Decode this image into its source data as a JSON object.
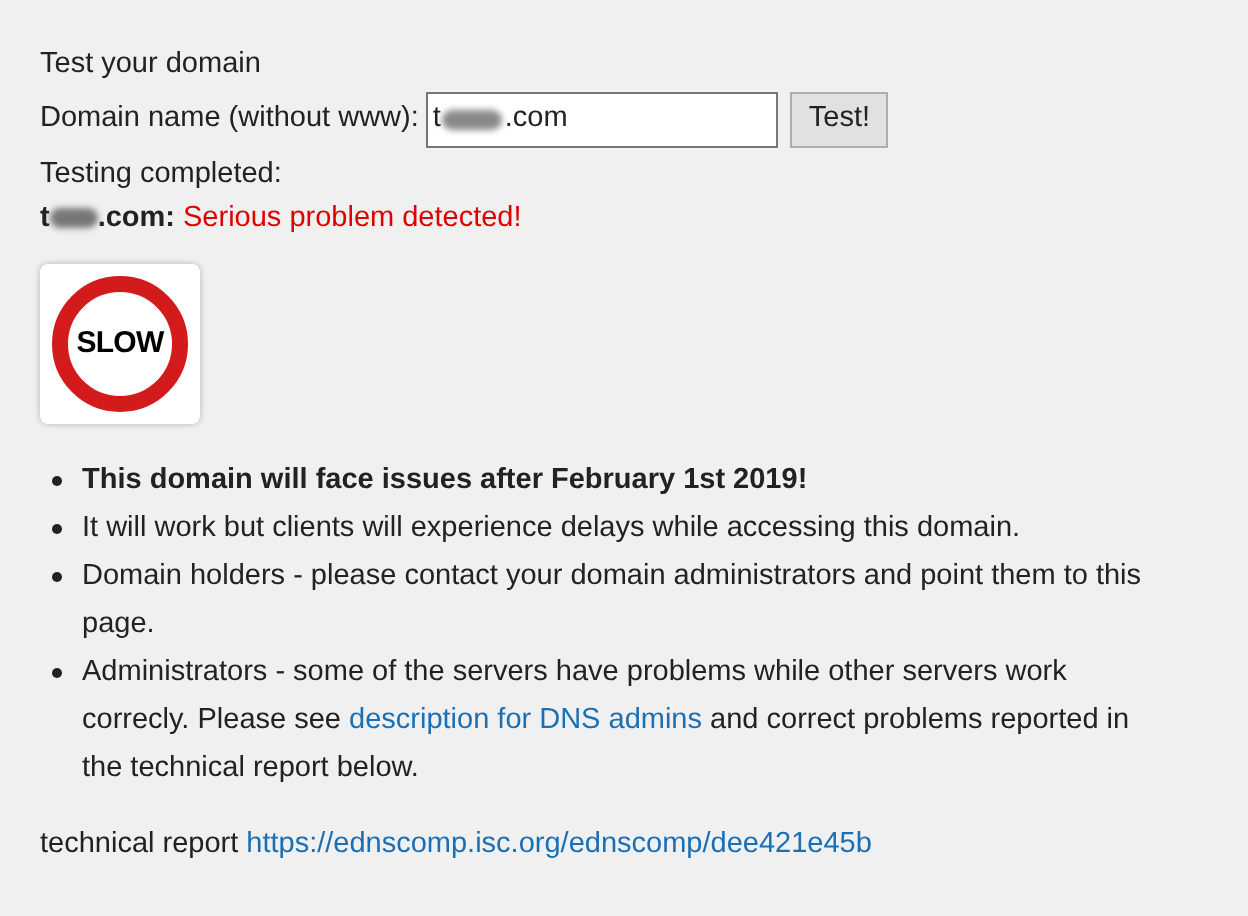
{
  "heading": "Test your domain",
  "domain_field": {
    "label": "Domain name (without www):",
    "value_start": "t",
    "value_end": ".com",
    "redacted": true
  },
  "test_button": "Test!",
  "status": "Testing completed:",
  "result": {
    "domain_start": "t",
    "domain_end": ".com:",
    "redacted": true,
    "message": "Serious problem detected!"
  },
  "sign": {
    "text": "SLOW"
  },
  "bullets": [
    {
      "bold": true,
      "parts": [
        {
          "kind": "text",
          "text": "This domain will face issues after February 1st 2019!"
        }
      ]
    },
    {
      "bold": false,
      "parts": [
        {
          "kind": "text",
          "text": "It will work but clients will experience delays while accessing this domain."
        }
      ]
    },
    {
      "bold": false,
      "parts": [
        {
          "kind": "text",
          "text": "Domain holders - please contact your domain administrators and point them to this page."
        }
      ]
    },
    {
      "bold": false,
      "parts": [
        {
          "kind": "text",
          "text": "Administrators - some of the servers have problems while other servers work correcly. Please see "
        },
        {
          "kind": "link",
          "text": "description for DNS admins"
        },
        {
          "kind": "text",
          "text": " and correct problems reported in the technical report below."
        }
      ]
    }
  ],
  "report": {
    "label": "technical report",
    "link": "https://ednscomp.isc.org/ednscomp/dee421e45b"
  }
}
